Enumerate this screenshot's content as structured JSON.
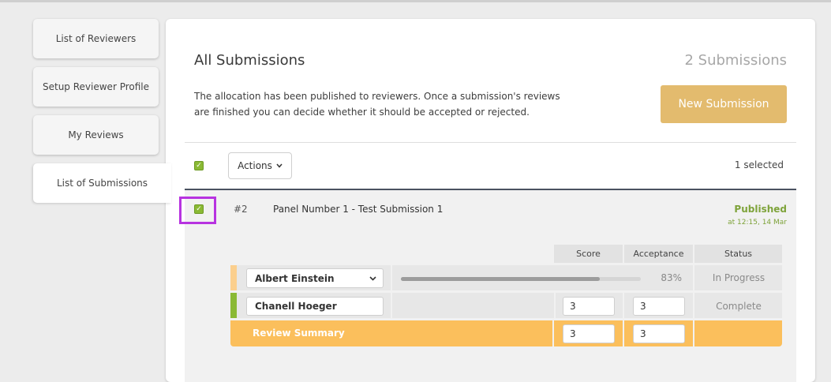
{
  "sidebar": {
    "items": [
      {
        "label": "List of Reviewers"
      },
      {
        "label": "Setup Reviewer Profile"
      },
      {
        "label": "My Reviews"
      },
      {
        "label": "List of Submissions"
      }
    ]
  },
  "header": {
    "title": "All Submissions",
    "count": "2 Submissions",
    "description": "The allocation has been published to reviewers. Once a submission's reviews are finished you can decide whether it should be accepted or rejected.",
    "new_button": "New Submission"
  },
  "toolbar": {
    "actions_label": "Actions",
    "selected_text": "1 selected"
  },
  "submission": {
    "number": "#2",
    "title": "Panel Number 1 - Test Submission 1",
    "status": "Published",
    "status_time": "at 12:15, 14 Mar"
  },
  "review_table": {
    "columns": [
      "Score",
      "Acceptance",
      "Status"
    ],
    "rows": [
      {
        "reviewer": "Albert Einstein",
        "progress": 0.83,
        "progress_label": "83%",
        "status": "In Progress"
      },
      {
        "reviewer": "Chanell Hoeger",
        "score": "3",
        "acceptance": "3",
        "status": "Complete"
      }
    ],
    "summary": {
      "label": "Review Summary",
      "score": "3",
      "acceptance": "3"
    }
  },
  "colors": {
    "accent_button": "#e3bb6e",
    "summary_row": "#fbbf5c",
    "published_green": "#7ea33a",
    "checkbox_green": "#8ab934",
    "in_progress_marker": "#fbcf8d",
    "complete_marker": "#8ab934",
    "highlight": "#b733e0"
  }
}
